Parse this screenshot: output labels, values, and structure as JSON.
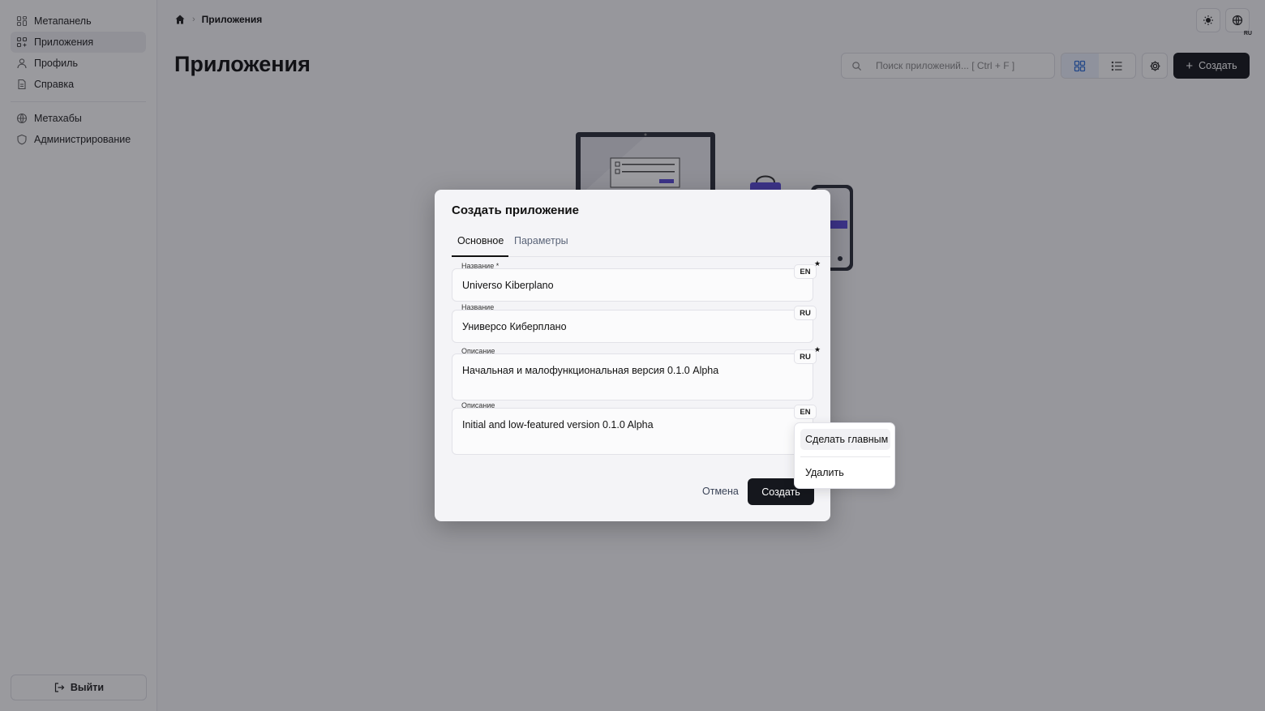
{
  "sidebar": {
    "items": [
      {
        "label": "Метапанель",
        "icon": "dashboard-icon"
      },
      {
        "label": "Приложения",
        "icon": "apps-icon",
        "active": true
      },
      {
        "label": "Профиль",
        "icon": "user-icon"
      },
      {
        "label": "Справка",
        "icon": "document-icon"
      }
    ],
    "items2": [
      {
        "label": "Метахабы",
        "icon": "globe-icon"
      },
      {
        "label": "Администрирование",
        "icon": "shield-icon"
      }
    ],
    "logout_label": "Выйти"
  },
  "header": {
    "breadcrumb": "Приложения",
    "lang_badge": "RU",
    "page_title": "Приложения",
    "search_placeholder": "Поиск приложений... [ Ctrl + F ]",
    "create_label": "Создать"
  },
  "modal": {
    "title": "Создать приложение",
    "tabs": [
      "Основное",
      "Параметры"
    ],
    "fields": [
      {
        "label": "Название *",
        "value": "Universo Kiberplano",
        "lang": "EN",
        "primary": true
      },
      {
        "label": "Название",
        "value": "Универсо Киберплано",
        "lang": "RU",
        "primary": false
      },
      {
        "label": "Описание",
        "value": "Начальная и малофункциональная версия 0.1.0 Alpha",
        "lang": "RU",
        "primary": true
      },
      {
        "label": "Описание",
        "value": "Initial and low-featured version 0.1.0 Alpha",
        "lang": "EN",
        "primary": false
      }
    ],
    "cancel_label": "Отмена",
    "submit_label": "Создать"
  },
  "menu": {
    "items": [
      "Сделать главным",
      "Удалить"
    ]
  },
  "colors": {
    "accent": "#15171d",
    "view_toggle_active": "#2f6fd6",
    "illustration_accent": "#5b4bd6"
  }
}
